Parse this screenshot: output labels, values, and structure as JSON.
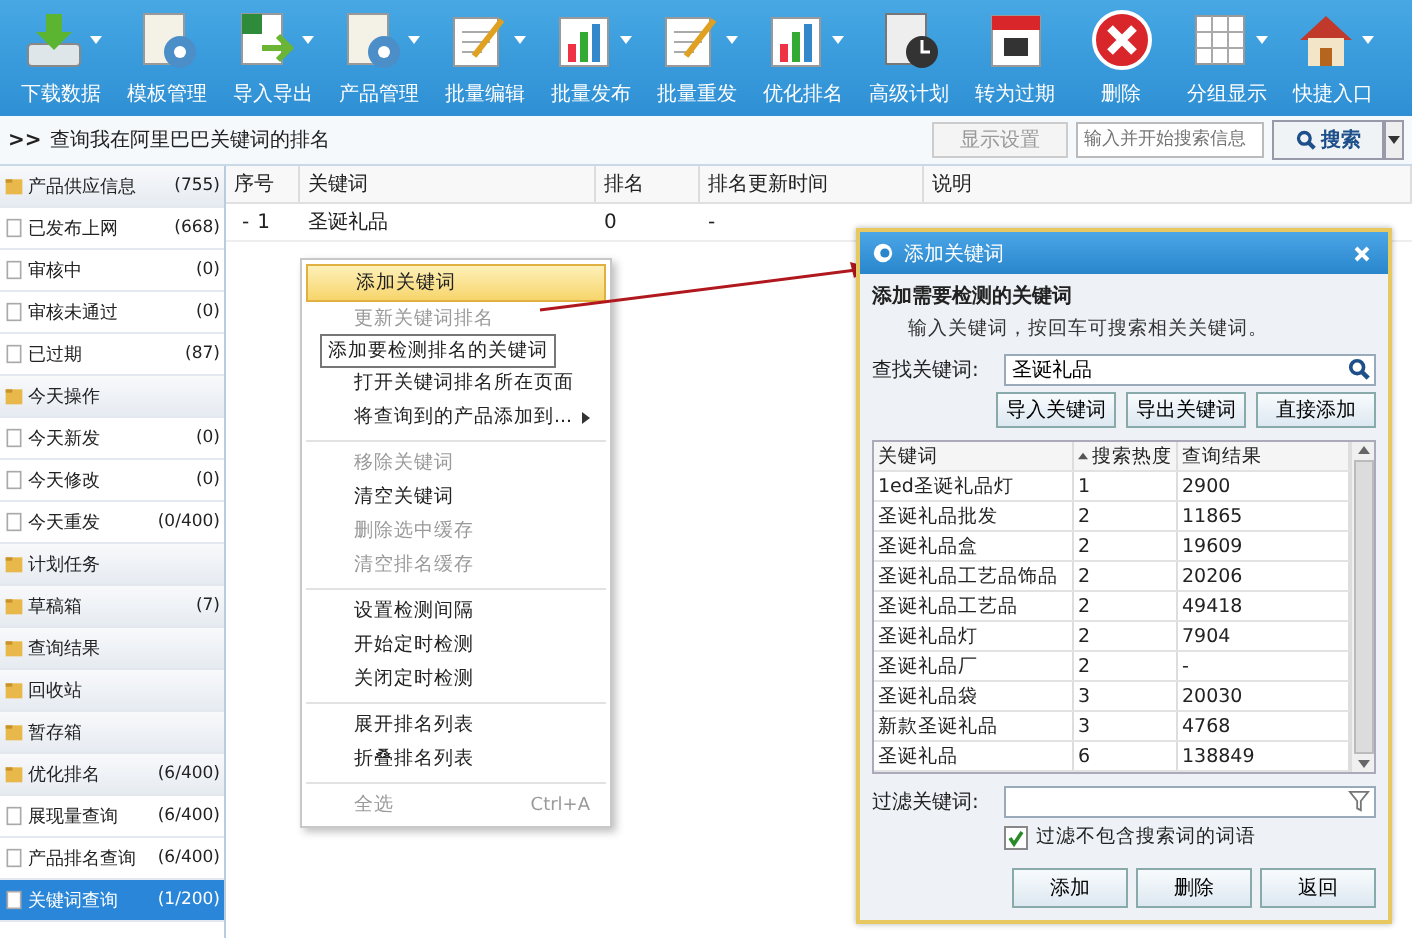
{
  "toolbar": [
    {
      "label": "下载数据",
      "dropdown": true
    },
    {
      "label": "模板管理",
      "dropdown": false
    },
    {
      "label": "导入导出",
      "dropdown": true
    },
    {
      "label": "产品管理",
      "dropdown": true
    },
    {
      "label": "批量编辑",
      "dropdown": true
    },
    {
      "label": "批量发布",
      "dropdown": true
    },
    {
      "label": "批量重发",
      "dropdown": true
    },
    {
      "label": "优化排名",
      "dropdown": true
    },
    {
      "label": "高级计划",
      "dropdown": false
    },
    {
      "label": "转为过期",
      "dropdown": false
    },
    {
      "label": "删除",
      "dropdown": false
    },
    {
      "label": "分组显示",
      "dropdown": true
    },
    {
      "label": "快捷入口",
      "dropdown": true
    }
  ],
  "breadcrumb": {
    "marker": ">>",
    "title": "查询我在阿里巴巴关键词的排名",
    "settings_button": "显示设置",
    "search_placeholder": "输入并开始搜索信息",
    "search_button": "搜索"
  },
  "sidebar": [
    {
      "kind": "group",
      "label": "产品供应信息",
      "count": "(755)",
      "selected": false
    },
    {
      "kind": "item",
      "label": "已发布上网",
      "count": "(668)",
      "selected": false
    },
    {
      "kind": "item",
      "label": "审核中",
      "count": "(0)",
      "selected": false
    },
    {
      "kind": "item",
      "label": "审核未通过",
      "count": "(0)",
      "selected": false
    },
    {
      "kind": "item",
      "label": "已过期",
      "count": "(87)",
      "selected": false
    },
    {
      "kind": "group",
      "label": "今天操作",
      "selected": false
    },
    {
      "kind": "item",
      "label": "今天新发",
      "count": "(0)",
      "selected": false
    },
    {
      "kind": "item",
      "label": "今天修改",
      "count": "(0)",
      "selected": false
    },
    {
      "kind": "item",
      "label": "今天重发",
      "count": "(0/400)",
      "selected": false
    },
    {
      "kind": "group",
      "label": "计划任务",
      "selected": false
    },
    {
      "kind": "group",
      "label": "草稿箱",
      "count": "(7)",
      "selected": false
    },
    {
      "kind": "group",
      "label": "查询结果",
      "selected": false
    },
    {
      "kind": "group",
      "label": "回收站",
      "selected": false
    },
    {
      "kind": "group",
      "label": "暂存箱",
      "selected": false
    },
    {
      "kind": "group",
      "label": "优化排名",
      "count": "(6/400)",
      "selected": false
    },
    {
      "kind": "item",
      "label": "展现量查询",
      "count": "(6/400)",
      "selected": false
    },
    {
      "kind": "item",
      "label": "产品排名查询",
      "count": "(6/400)",
      "selected": false
    },
    {
      "kind": "item",
      "label": "关键词查询",
      "count": "(1/200)",
      "selected": true
    }
  ],
  "table": {
    "columns": [
      "序号",
      "关键词",
      "排名",
      "排名更新时间",
      "说明"
    ],
    "rows": [
      {
        "expander": "-",
        "index": "1",
        "keyword": "圣诞礼品",
        "rank": "0",
        "updated": "-"
      }
    ]
  },
  "context_menu": [
    {
      "label": "添加关键词",
      "disabled": false,
      "selected": true,
      "separator_before": false
    },
    {
      "label": "更新关键词排名",
      "disabled": true,
      "selected": false,
      "separator_before": false
    },
    {
      "label": "打开关键词排名所在页面",
      "disabled": false,
      "selected": false,
      "separator_before": false
    },
    {
      "label": "将查询到的产品添加到...",
      "disabled": false,
      "selected": false,
      "separator_before": false,
      "submenu": true
    },
    {
      "label": "移除关键词",
      "disabled": true,
      "selected": false,
      "separator_before": true
    },
    {
      "label": "清空关键词",
      "disabled": false,
      "selected": false,
      "separator_before": false
    },
    {
      "label": "删除选中缓存",
      "disabled": true,
      "selected": false,
      "separator_before": false
    },
    {
      "label": "清空排名缓存",
      "disabled": true,
      "selected": false,
      "separator_before": false
    },
    {
      "label": "设置检测间隔",
      "disabled": false,
      "selected": false,
      "separator_before": true
    },
    {
      "label": "开始定时检测",
      "disabled": false,
      "selected": false,
      "separator_before": false
    },
    {
      "label": "关闭定时检测",
      "disabled": false,
      "selected": false,
      "separator_before": false
    },
    {
      "label": "展开排名列表",
      "disabled": false,
      "selected": false,
      "separator_before": true
    },
    {
      "label": "折叠排名列表",
      "disabled": false,
      "selected": false,
      "separator_before": false
    },
    {
      "label": "全选",
      "shortcut": "Ctrl+A",
      "disabled": true,
      "selected": false,
      "separator_before": true
    }
  ],
  "tooltip": "添加要检测排名的关键词",
  "dialog": {
    "title": "添加关键词",
    "heading": "添加需要检测的关键词",
    "hint": "输入关键词，按回车可搜索相关关键词。",
    "find_label": "查找关键词:",
    "find_value": "圣诞礼品",
    "buttons": [
      "导入关键词",
      "导出关键词",
      "直接添加"
    ],
    "columns": [
      "关键词",
      "搜索热度",
      "查询结果"
    ],
    "rows": [
      [
        "1ed圣诞礼品灯",
        "1",
        "2900"
      ],
      [
        "圣诞礼品批发",
        "2",
        "11865"
      ],
      [
        "圣诞礼品盒",
        "2",
        "19609"
      ],
      [
        "圣诞礼品工艺品饰品",
        "2",
        "20206"
      ],
      [
        "圣诞礼品工艺品",
        "2",
        "49418"
      ],
      [
        "圣诞礼品灯",
        "2",
        "7904"
      ],
      [
        "圣诞礼品厂",
        "2",
        "-"
      ],
      [
        "圣诞礼品袋",
        "3",
        "20030"
      ],
      [
        "新款圣诞礼品",
        "3",
        "4768"
      ],
      [
        "圣诞礼品",
        "6",
        "138849"
      ]
    ],
    "filter_label": "过滤关键词:",
    "filter_checkbox": {
      "label": "过滤不包含搜索词的词语",
      "checked": true
    },
    "footer_buttons": [
      "添加",
      "删除",
      "返回"
    ]
  }
}
